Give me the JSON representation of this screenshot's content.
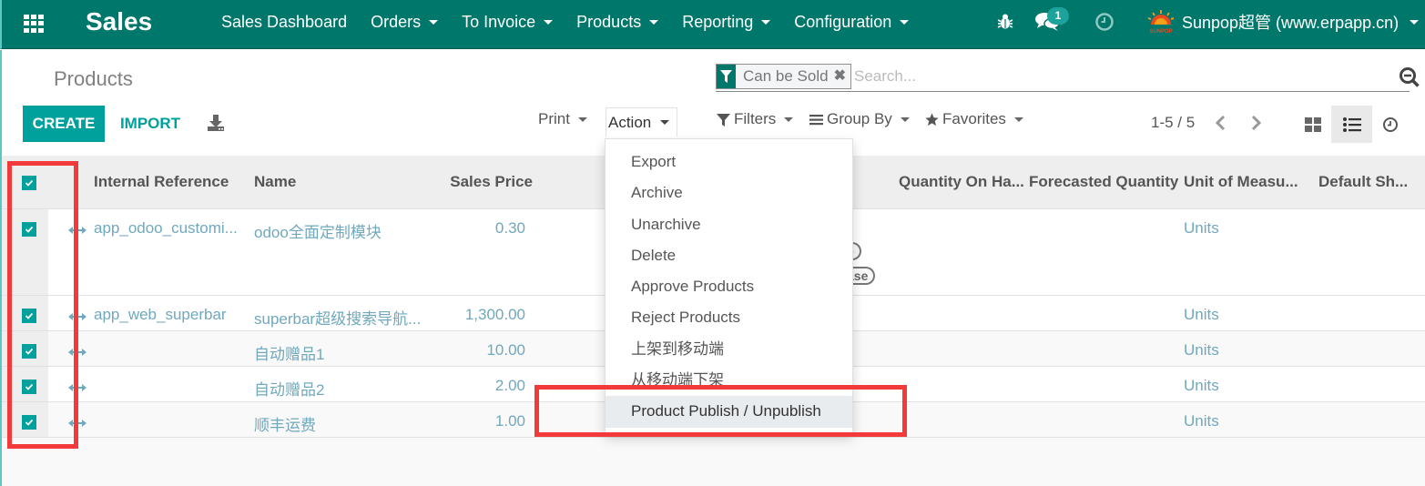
{
  "navbar": {
    "app_name": "Sales",
    "menu": [
      {
        "label": "Sales Dashboard",
        "dropdown": false
      },
      {
        "label": "Orders",
        "dropdown": true
      },
      {
        "label": "To Invoice",
        "dropdown": true
      },
      {
        "label": "Products",
        "dropdown": true
      },
      {
        "label": "Reporting",
        "dropdown": true
      },
      {
        "label": "Configuration",
        "dropdown": true
      }
    ],
    "icons": {
      "apps": "apps-grid-icon",
      "debug": "bug-icon",
      "messages": "chat-icon",
      "activities": "clock-icon"
    },
    "message_count": "1",
    "user_name": "Sunpop超管 (www.erpapp.cn)",
    "logo_text": "SUNPOP",
    "colors": {
      "primary": "#00776b",
      "accent": "#00a09d",
      "link": "#70a8bc",
      "badge": "#1ba39c",
      "annotation": "#f23a3a"
    }
  },
  "control_panel": {
    "breadcrumb": "Products",
    "search": {
      "facet_label": "Can be Sold",
      "facet_icon": "filter-icon",
      "placeholder": "Search...",
      "value": ""
    },
    "buttons": {
      "create": "CREATE",
      "import": "IMPORT",
      "download_icon": "download-icon"
    },
    "print_label": "Print",
    "action_label": "Action",
    "filters_label": "Filters",
    "groupby_label": "Group By",
    "favorites_label": "Favorites",
    "pager": "1-5 / 5",
    "views": [
      "kanban",
      "list",
      "activity"
    ],
    "active_view": "list"
  },
  "action_menu": {
    "items": [
      "Export",
      "Archive",
      "Unarchive",
      "Delete",
      "Approve Products",
      "Reject Products",
      "上架到移动端",
      "从移动端下架",
      "Product Publish / Unpublish"
    ],
    "highlighted": "Product Publish / Unpublish"
  },
  "table": {
    "all_selected": true,
    "columns": [
      "Internal Reference",
      "Name",
      "Sales Price",
      "",
      "",
      "Quantity On Ha...",
      "Forecasted Quantity",
      "Unit of Measu...",
      "Default Sh..."
    ],
    "rows": [
      {
        "selected": true,
        "ref": "app_odoo_customi...",
        "name": "odoo全面定制模块",
        "price": "0.30",
        "uom": "Units",
        "tags": [
          "e",
          "ase"
        ]
      },
      {
        "selected": true,
        "ref": "app_web_superbar",
        "name": "superbar超级搜索导航...",
        "price": "1,300.00",
        "uom": "Units"
      },
      {
        "selected": true,
        "ref": "",
        "name": "自动赠品1",
        "price": "10.00",
        "uom": "Units"
      },
      {
        "selected": true,
        "ref": "",
        "name": "自动赠品2",
        "price": "2.00",
        "uom": "Units"
      },
      {
        "selected": true,
        "ref": "",
        "name": "顺丰运费",
        "price": "1.00",
        "uom": "Units"
      }
    ]
  }
}
